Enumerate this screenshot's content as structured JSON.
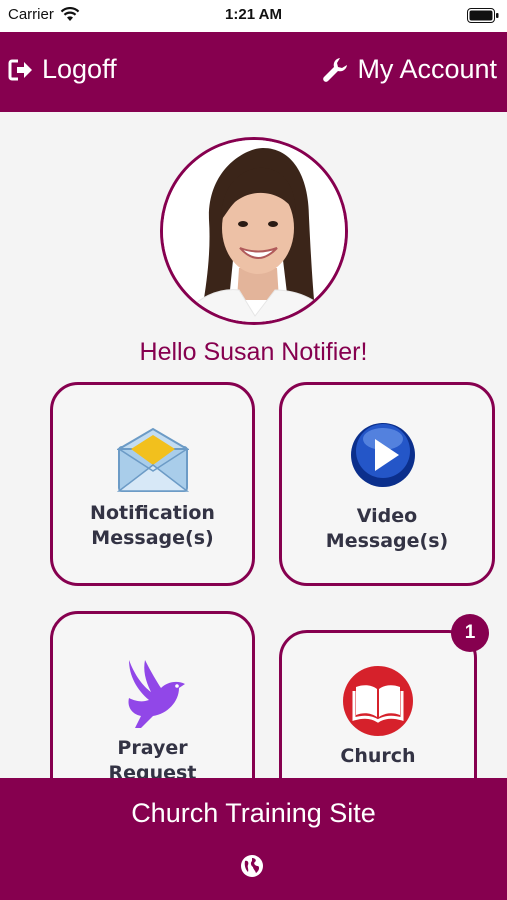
{
  "status_bar": {
    "carrier": "Carrier",
    "time": "1:21 AM"
  },
  "header": {
    "logoff_label": "Logoff",
    "account_label": "My Account",
    "logoff_icon": "sign-out-icon",
    "account_icon": "wrench-icon"
  },
  "profile": {
    "greeting": "Hello Susan Notifier!"
  },
  "tiles": [
    {
      "line1": "Notification",
      "line2": "Message(s)",
      "icon": "envelope-icon"
    },
    {
      "line1": "Video",
      "line2": "Message(s)",
      "icon": "play-icon"
    },
    {
      "line1": "Prayer",
      "line2": "Request",
      "icon": "dove-icon"
    },
    {
      "line1": "Church",
      "line2": "",
      "icon": "book-icon",
      "badge": "1"
    }
  ],
  "footer": {
    "title": "Church Training Site",
    "icon": "globe-icon"
  },
  "colors": {
    "brand": "#86004f",
    "background": "#f4f4f4",
    "tile_text": "#333344"
  }
}
